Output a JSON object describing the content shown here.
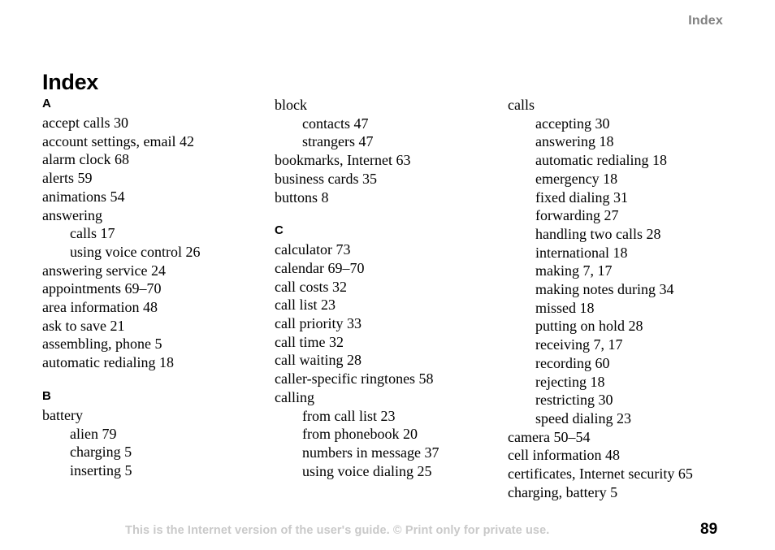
{
  "header": {
    "running_head": "Index"
  },
  "title": "Index",
  "columns": [
    {
      "id": "column-1",
      "sections": [
        {
          "letter": "A",
          "entries": [
            {
              "text": "accept calls 30",
              "level": 0
            },
            {
              "text": "account settings, email 42",
              "level": 0
            },
            {
              "text": "alarm clock 68",
              "level": 0
            },
            {
              "text": "alerts 59",
              "level": 0
            },
            {
              "text": "animations 54",
              "level": 0
            },
            {
              "text": "answering",
              "level": 0
            },
            {
              "text": "calls 17",
              "level": 1
            },
            {
              "text": "using voice control 26",
              "level": 1
            },
            {
              "text": "answering service 24",
              "level": 0
            },
            {
              "text": "appointments 69–70",
              "level": 0
            },
            {
              "text": "area information 48",
              "level": 0
            },
            {
              "text": "ask to save 21",
              "level": 0
            },
            {
              "text": "assembling, phone 5",
              "level": 0
            },
            {
              "text": "automatic redialing 18",
              "level": 0
            }
          ]
        },
        {
          "letter": "B",
          "entries": [
            {
              "text": "battery",
              "level": 0
            },
            {
              "text": "alien 79",
              "level": 1
            },
            {
              "text": "charging 5",
              "level": 1
            },
            {
              "text": "inserting 5",
              "level": 1
            }
          ]
        }
      ]
    },
    {
      "id": "column-2",
      "sections": [
        {
          "letter": "",
          "entries": [
            {
              "text": "block",
              "level": 0
            },
            {
              "text": "contacts 47",
              "level": 1
            },
            {
              "text": "strangers 47",
              "level": 1
            },
            {
              "text": "bookmarks, Internet 63",
              "level": 0
            },
            {
              "text": "business cards 35",
              "level": 0
            },
            {
              "text": "buttons 8",
              "level": 0
            }
          ]
        },
        {
          "letter": "C",
          "entries": [
            {
              "text": "calculator 73",
              "level": 0
            },
            {
              "text": "calendar 69–70",
              "level": 0
            },
            {
              "text": "call costs 32",
              "level": 0
            },
            {
              "text": "call list 23",
              "level": 0
            },
            {
              "text": "call priority 33",
              "level": 0
            },
            {
              "text": "call time 32",
              "level": 0
            },
            {
              "text": "call waiting 28",
              "level": 0
            },
            {
              "text": "caller-specific ringtones 58",
              "level": 0
            },
            {
              "text": "calling",
              "level": 0
            },
            {
              "text": "from call list 23",
              "level": 1
            },
            {
              "text": "from phonebook 20",
              "level": 1
            },
            {
              "text": "numbers in message 37",
              "level": 1
            },
            {
              "text": "using voice dialing 25",
              "level": 1
            }
          ]
        }
      ]
    },
    {
      "id": "column-3",
      "sections": [
        {
          "letter": "",
          "entries": [
            {
              "text": "calls",
              "level": 0
            },
            {
              "text": "accepting 30",
              "level": 1
            },
            {
              "text": "answering 18",
              "level": 1
            },
            {
              "text": "automatic redialing 18",
              "level": 1
            },
            {
              "text": "emergency 18",
              "level": 1
            },
            {
              "text": "fixed dialing 31",
              "level": 1
            },
            {
              "text": "forwarding 27",
              "level": 1
            },
            {
              "text": "handling two calls 28",
              "level": 1
            },
            {
              "text": "international 18",
              "level": 1
            },
            {
              "text": "making 7, 17",
              "level": 1
            },
            {
              "text": "making notes during 34",
              "level": 1
            },
            {
              "text": "missed 18",
              "level": 1
            },
            {
              "text": "putting on hold 28",
              "level": 1
            },
            {
              "text": "receiving 7, 17",
              "level": 1
            },
            {
              "text": "recording 60",
              "level": 1
            },
            {
              "text": "rejecting 18",
              "level": 1
            },
            {
              "text": "restricting 30",
              "level": 1
            },
            {
              "text": "speed dialing 23",
              "level": 1
            },
            {
              "text": "camera 50–54",
              "level": 0
            },
            {
              "text": "cell information 48",
              "level": 0
            },
            {
              "text": "certificates, Internet security 65",
              "level": 0
            },
            {
              "text": "charging, battery 5",
              "level": 0
            }
          ]
        }
      ]
    }
  ],
  "footer": {
    "note": "This is the Internet version of the user's guide. © Print only for private use.",
    "page_number": "89"
  }
}
